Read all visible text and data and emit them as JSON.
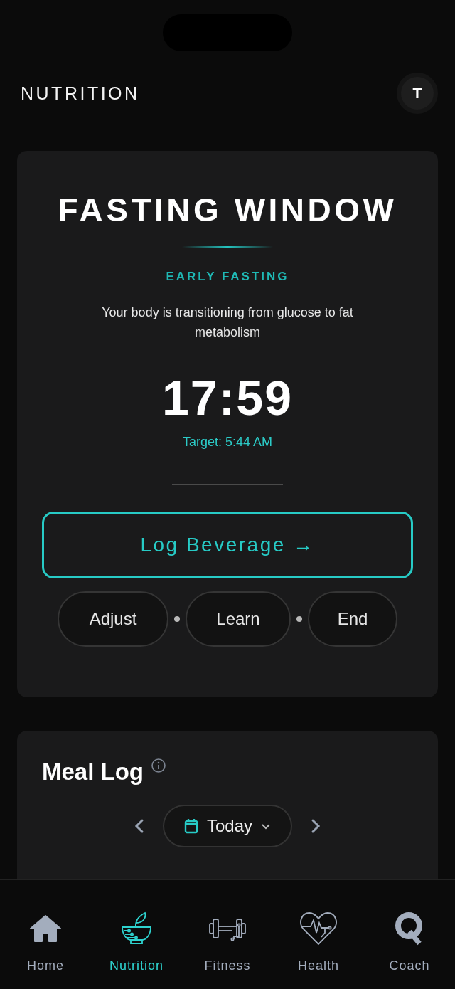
{
  "header": {
    "title": "NUTRITION",
    "avatar": "T"
  },
  "fasting": {
    "title": "FASTING WINDOW",
    "phase": "EARLY FASTING",
    "description": "Your body is transitioning from glucose to fat metabolism",
    "timer": "17:59",
    "target": "Target: 5:44 AM",
    "primary_action": "Log Beverage →",
    "actions": [
      "Adjust",
      "Learn",
      "End"
    ]
  },
  "meal_log": {
    "title": "Meal Log",
    "date": "Today"
  },
  "tabs": [
    {
      "label": "Home",
      "selected": false
    },
    {
      "label": "Nutrition",
      "selected": true
    },
    {
      "label": "Fitness",
      "selected": false
    },
    {
      "label": "Health",
      "selected": false
    },
    {
      "label": "Coach",
      "selected": false
    }
  ]
}
